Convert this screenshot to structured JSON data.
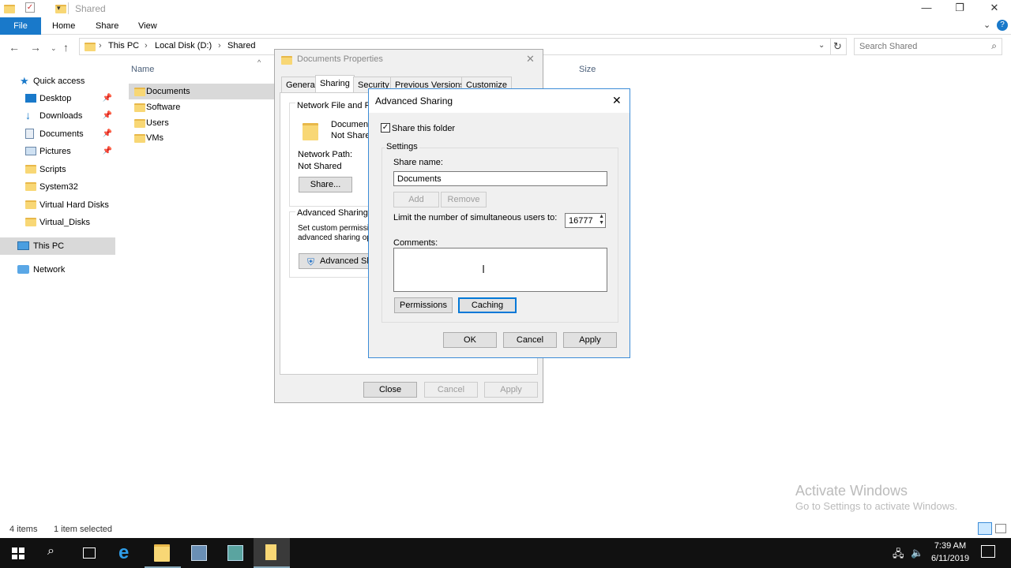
{
  "window": {
    "title": "Shared",
    "minimize": "—",
    "maximize": "❐",
    "close": "✕"
  },
  "ribbon": {
    "file": "File",
    "tabs": [
      "Home",
      "Share",
      "View"
    ]
  },
  "address": {
    "crumbs": [
      "This PC",
      "Local Disk (D:)",
      "Shared"
    ],
    "search_placeholder": "Search Shared"
  },
  "nav": {
    "quick_access": "Quick access",
    "items": [
      "Desktop",
      "Downloads",
      "Documents",
      "Pictures",
      "Scripts",
      "System32",
      "Virtual Hard Disks",
      "Virtual_Disks"
    ],
    "this_pc": "This PC",
    "network": "Network"
  },
  "filelist": {
    "col_name": "Name",
    "col_size": "Size",
    "files": [
      "Documents",
      "Software",
      "Users",
      "VMs"
    ]
  },
  "status": {
    "count": "4 items",
    "selected": "1 item selected"
  },
  "properties": {
    "title": "Documents Properties",
    "tabs": [
      "General",
      "Sharing",
      "Security",
      "Previous Versions",
      "Customize"
    ],
    "group1_title": "Network File and Fol",
    "folder_name": "Documents",
    "folder_state": "Not Shared",
    "path_label": "Network Path:",
    "path_value": "Not Shared",
    "share_btn": "Share...",
    "group2_title": "Advanced Sharing",
    "group2_line1": "Set custom permissic",
    "group2_line2": "advanced sharing op",
    "adv_btn": "Advanced Sh",
    "close": "Close",
    "cancel": "Cancel",
    "apply": "Apply"
  },
  "advanced": {
    "title": "Advanced Sharing",
    "share_checkbox": "Share this folder",
    "settings": "Settings",
    "share_name_label": "Share name:",
    "share_name_value": "Documents",
    "add": "Add",
    "remove": "Remove",
    "limit_label": "Limit the number of simultaneous users to:",
    "limit_value": "16777",
    "comments_label": "Comments:",
    "permissions": "Permissions",
    "caching": "Caching",
    "ok": "OK",
    "cancel": "Cancel",
    "apply": "Apply"
  },
  "watermark": {
    "line1": "Activate Windows",
    "line2": "Go to Settings to activate Windows."
  },
  "taskbar": {
    "time": "7:39 AM",
    "date": "6/11/2019"
  },
  "colors": {
    "accent": "#1979ca",
    "selection": "#cce8ff",
    "folder": "#f8d775"
  }
}
